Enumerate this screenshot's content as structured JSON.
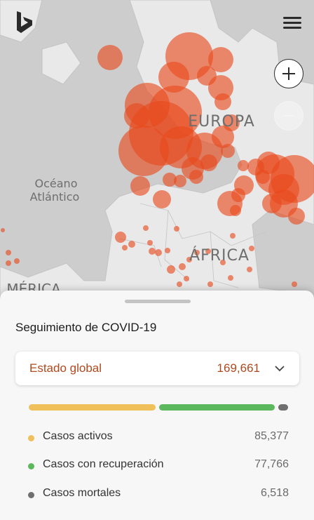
{
  "map": {
    "labels": {
      "ocean": [
        "Océano",
        "Atlántico"
      ],
      "europe": "EUROPA",
      "africa": "ÁFRICA",
      "america": "MÉRICA"
    },
    "colors": {
      "land": "#e9e9e9",
      "water": "#cdcdcd",
      "borders": "#c4c4c4",
      "bubble": "#e8491c"
    }
  },
  "icons": {
    "logo": "bing-logo-icon",
    "menu": "hamburger-menu-icon",
    "zoom_in": "plus-icon",
    "zoom_out": "minus-icon",
    "dropdown": "chevron-down-icon"
  },
  "panel": {
    "title": "Seguimiento de COVID-19",
    "global": {
      "label": "Estado global",
      "value": "169,661"
    },
    "breakdown_fractions": {
      "active": 0.503,
      "recovered": 0.458,
      "deaths": 0.038
    },
    "colors": {
      "accent": "#b0491e",
      "active": "#f0c05a",
      "recovered": "#5cb85c",
      "deaths": "#6f6f6f"
    },
    "stats": [
      {
        "label": "Casos activos",
        "value": "85,377"
      },
      {
        "label": "Casos con recuperación",
        "value": "77,766"
      },
      {
        "label": "Casos mortales",
        "value": "6,518"
      }
    ]
  }
}
